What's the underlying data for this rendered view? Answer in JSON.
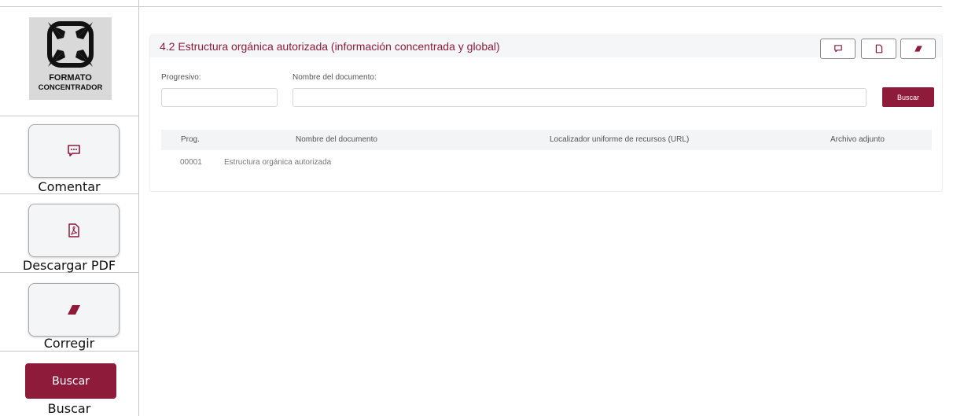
{
  "sidebar": {
    "logo": {
      "line1": "FORMATO",
      "line2": "CONCENTRADOR"
    },
    "comment_label": "Comentar",
    "pdf_label": "Descargar PDF",
    "correct_label": "Corregir",
    "search_button": "Buscar",
    "search_label": "Buscar"
  },
  "panel": {
    "title": "4.2 Estructura orgánica autorizada (información concentrada y global)",
    "filters": {
      "progresivo_label": "Progresivo:",
      "progresivo_value": "",
      "nombre_label": "Nombre del documento:",
      "nombre_value": "",
      "search_button": "Buscar"
    },
    "table": {
      "columns": [
        "Prog.",
        "Nombre del documento",
        "Localizador uniforme de recursos (URL)",
        "Archivo adjunto"
      ],
      "rows": [
        {
          "prog": "00001",
          "nombre": "Estructura orgánica autorizada",
          "url": "",
          "archivo": ""
        }
      ]
    }
  },
  "colors": {
    "accent": "#8e1b3a",
    "border": "#c8c8c8",
    "header_bg": "#f5f6f8"
  },
  "icons": [
    "comment-icon",
    "pdf-icon",
    "eraser-icon"
  ]
}
